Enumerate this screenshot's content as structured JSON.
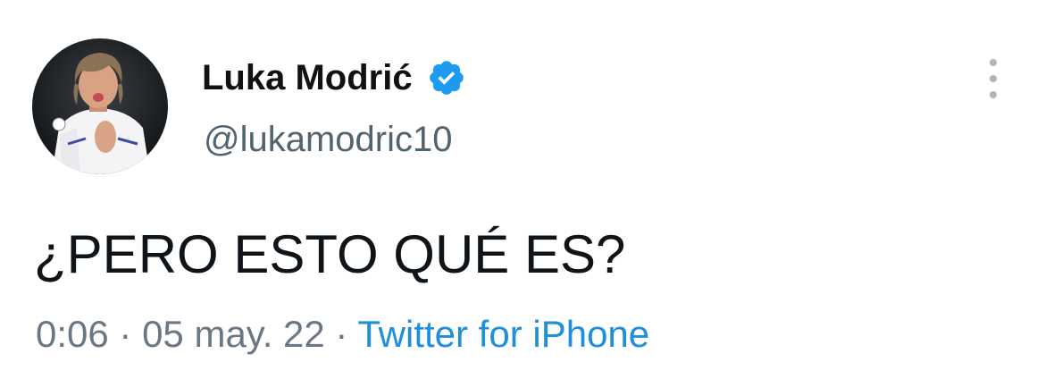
{
  "tweet": {
    "display_name": "Luka Modrić",
    "handle": "@lukamodric10",
    "verified": true,
    "text": "¿PERO ESTO QUÉ ES?",
    "time": "0:06",
    "separator": " · ",
    "date": "05 may. 22",
    "source": "Twitter for iPhone"
  },
  "icons": {
    "verified": "verified-badge-icon",
    "more": "more-options-icon",
    "avatar": "profile-avatar"
  },
  "colors": {
    "verified_badge": "#1d9bf0",
    "source_link": "#1d8fdc",
    "secondary_text": "#536471"
  }
}
